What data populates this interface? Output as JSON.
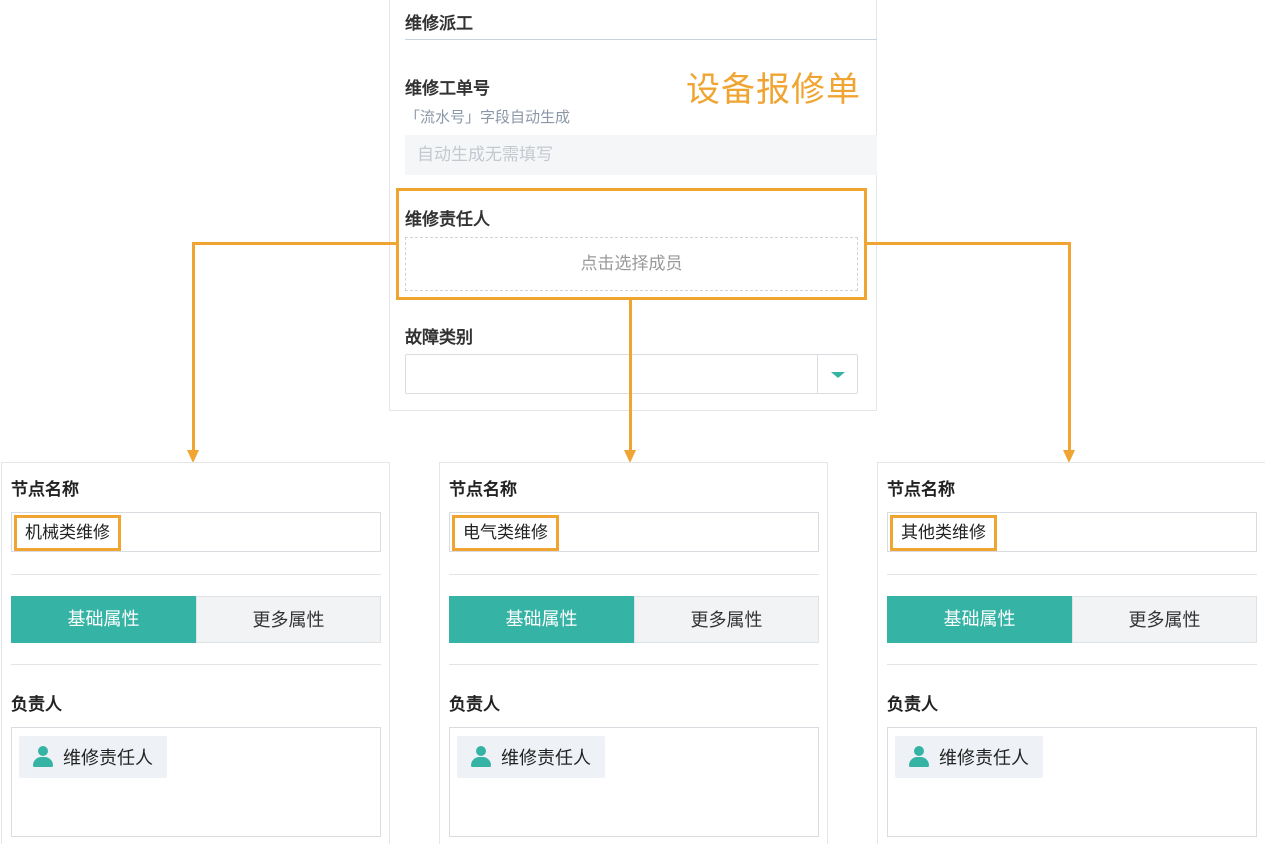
{
  "form": {
    "section_title": "维修派工",
    "big_title": "设备报修单",
    "order_no": {
      "label": "维修工单号",
      "desc": "「流水号」字段自动生成",
      "placeholder": "自动生成无需填写"
    },
    "assignee": {
      "label": "维修责任人",
      "picker_text": "点击选择成员"
    },
    "fault_type": {
      "label": "故障类别",
      "selected": ""
    }
  },
  "colors": {
    "accent": "#35b3a5",
    "highlight": "#f0a532"
  },
  "nodes": [
    {
      "name_label": "节点名称",
      "name_value": "机械类维修",
      "tab_basic": "基础属性",
      "tab_more": "更多属性",
      "owner_label": "负责人",
      "owner_chip": "维修责任人"
    },
    {
      "name_label": "节点名称",
      "name_value": "电气类维修",
      "tab_basic": "基础属性",
      "tab_more": "更多属性",
      "owner_label": "负责人",
      "owner_chip": "维修责任人"
    },
    {
      "name_label": "节点名称",
      "name_value": "其他类维修",
      "tab_basic": "基础属性",
      "tab_more": "更多属性",
      "owner_label": "负责人",
      "owner_chip": "维修责任人"
    }
  ]
}
